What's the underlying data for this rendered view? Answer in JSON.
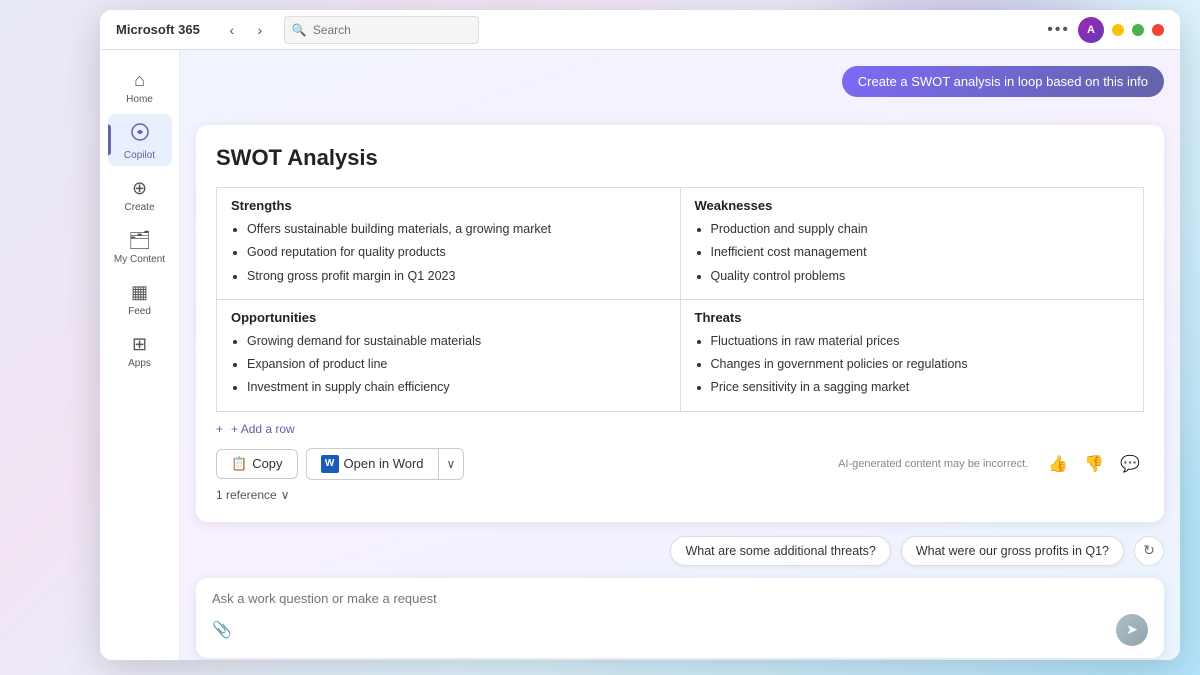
{
  "window": {
    "title": "Microsoft 365"
  },
  "titlebar": {
    "search_placeholder": "Search",
    "dots_label": "•••"
  },
  "sidebar": {
    "items": [
      {
        "id": "home",
        "label": "Home",
        "icon": "⌂"
      },
      {
        "id": "copilot",
        "label": "Copilot",
        "icon": "◎",
        "active": true
      },
      {
        "id": "create",
        "label": "Create",
        "icon": "+"
      },
      {
        "id": "my-content",
        "label": "My Content",
        "icon": "📁"
      },
      {
        "id": "feed",
        "label": "Feed",
        "icon": "▦"
      },
      {
        "id": "apps",
        "label": "Apps",
        "icon": "⊞"
      }
    ]
  },
  "chat": {
    "user_message": "Create a SWOT analysis in loop based on this info",
    "swot": {
      "title": "SWOT Analysis",
      "strengths": {
        "header": "Strengths",
        "items": [
          "Offers sustainable building materials, a growing market",
          "Good reputation for quality products",
          "Strong gross profit margin in Q1 2023"
        ]
      },
      "weaknesses": {
        "header": "Weaknesses",
        "items": [
          "Production and supply chain",
          "Inefficient cost management",
          "Quality control problems"
        ]
      },
      "opportunities": {
        "header": "Opportunities",
        "items": [
          "Growing demand for sustainable materials",
          "Expansion of product line",
          "Investment in supply chain efficiency"
        ]
      },
      "threats": {
        "header": "Threats",
        "items": [
          "Fluctuations in raw material prices",
          "Changes in government policies or regulations",
          "Price sensitivity in a sagging market"
        ]
      },
      "add_row_label": "+ Add a row"
    },
    "copy_button": "Copy",
    "open_word_button": "Open in Word",
    "ai_disclaimer": "AI-generated content may be incorrect.",
    "reference_label": "1 reference",
    "suggestions": [
      "What are some additional threats?",
      "What were our gross profits in Q1?"
    ]
  },
  "input": {
    "placeholder": "Ask a work question or make a request"
  },
  "icons": {
    "search": "🔍",
    "copy": "📋",
    "thumbup": "👍",
    "thumbdown": "👎",
    "comment": "💬",
    "refresh": "↻",
    "send": "➤",
    "attach": "📎",
    "chevron_down": "∨",
    "back": "‹",
    "forward": "›"
  },
  "colors": {
    "accent": "#6264a7",
    "user_bubble": "#7c6af7",
    "word_blue": "#185abd"
  }
}
